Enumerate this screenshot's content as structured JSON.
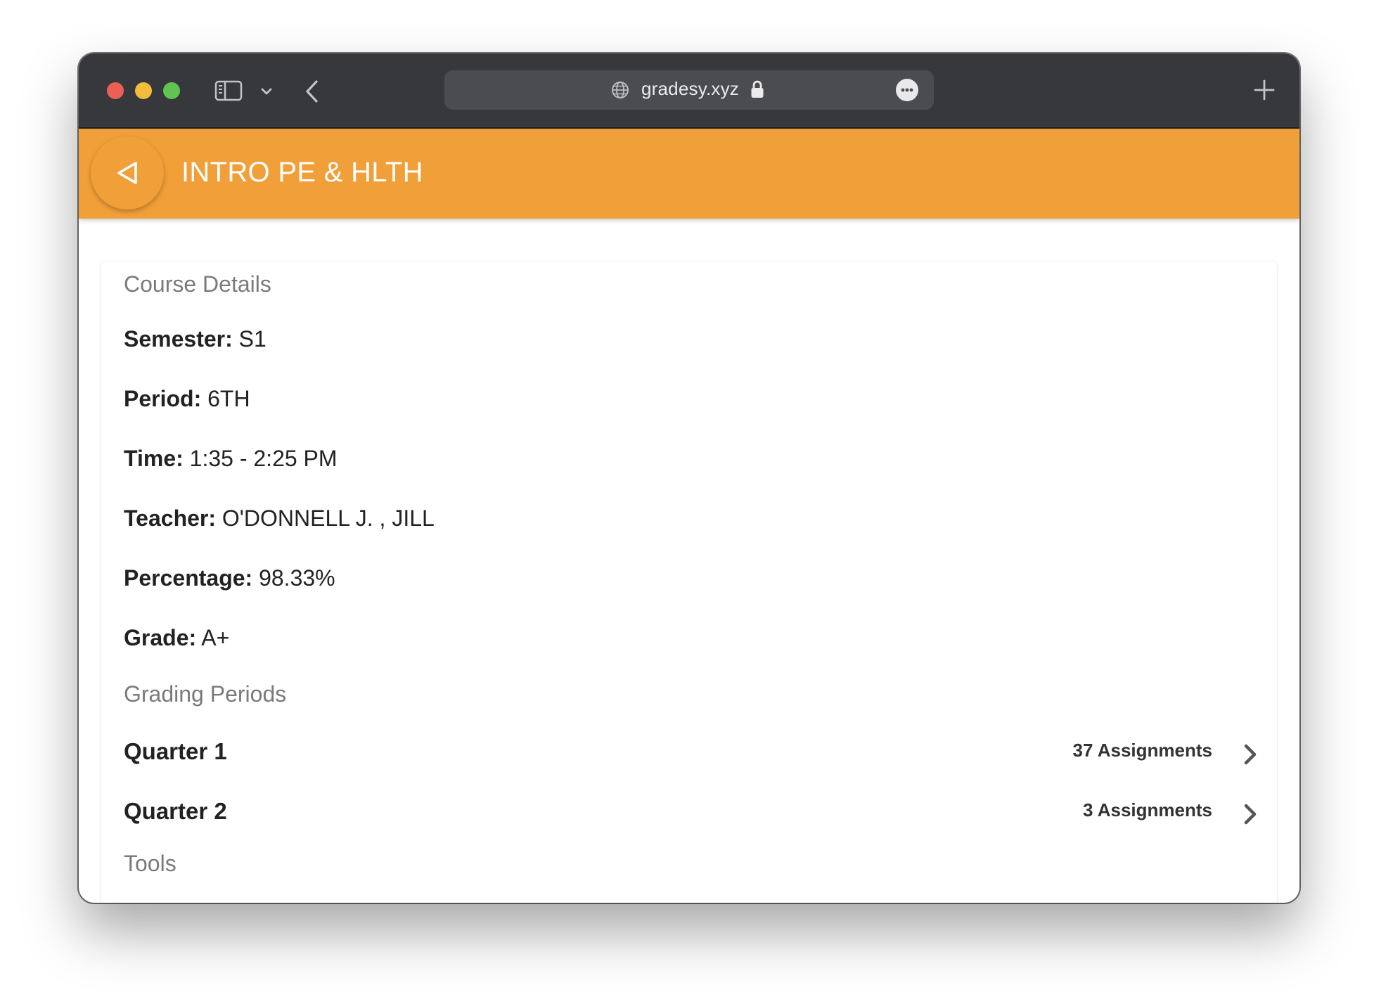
{
  "browser": {
    "url": "gradesy.xyz"
  },
  "header": {
    "title": "INTRO PE & HLTH",
    "accent_color": "#f19f38"
  },
  "course_details": {
    "heading": "Course Details",
    "fields": [
      {
        "label": "Semester:",
        "value": "S1"
      },
      {
        "label": "Period:",
        "value": "6TH"
      },
      {
        "label": "Time:",
        "value": "1:35 - 2:25 PM"
      },
      {
        "label": "Teacher:",
        "value": "O'DONNELL J. , JILL"
      },
      {
        "label": "Percentage:",
        "value": "98.33%"
      },
      {
        "label": "Grade:",
        "value": "A+"
      }
    ]
  },
  "grading_periods": {
    "heading": "Grading Periods",
    "items": [
      {
        "name": "Quarter 1",
        "count": "37 Assignments"
      },
      {
        "name": "Quarter 2",
        "count": "3 Assignments"
      }
    ]
  },
  "tools": {
    "heading": "Tools"
  },
  "icons": {
    "window_controls": [
      "close-icon",
      "minimize-icon",
      "zoom-icon"
    ],
    "toolbar": [
      "sidebar-icon",
      "chevron-down-icon",
      "back-arrow-icon",
      "globe-icon",
      "lock-icon",
      "more-icon",
      "plus-icon"
    ],
    "header": "triangle-back-icon",
    "row": "chevron-right-icon"
  }
}
